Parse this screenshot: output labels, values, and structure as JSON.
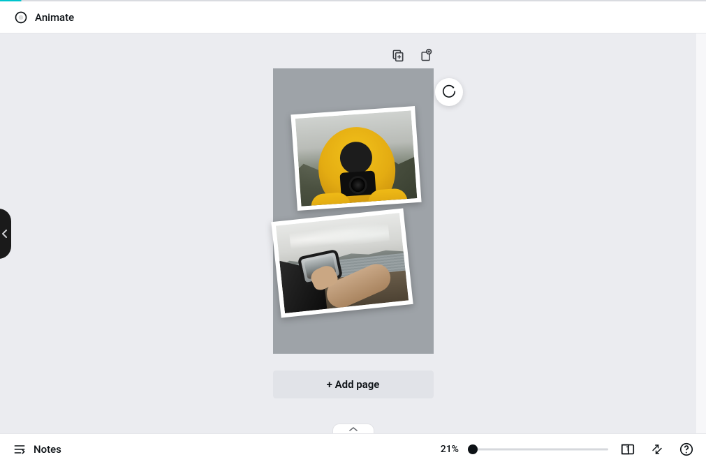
{
  "header": {
    "animate_label": "Animate"
  },
  "canvas": {
    "add_page_label": "+ Add page"
  },
  "footer": {
    "notes_label": "Notes",
    "zoom_percent_label": "21%",
    "zoom_value": 21,
    "zoom_min": 5,
    "zoom_max": 500,
    "page_count": "1"
  }
}
